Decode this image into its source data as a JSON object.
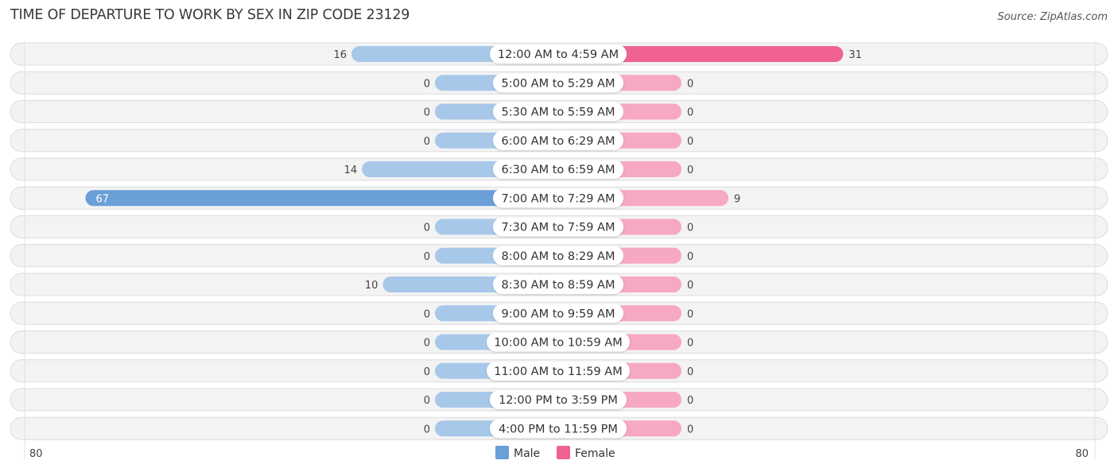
{
  "header": {
    "title": "TIME OF DEPARTURE TO WORK BY SEX IN ZIP CODE 23129",
    "source": "Source: ZipAtlas.com"
  },
  "chart_data": {
    "type": "bar",
    "orientation": "horizontal-diverging",
    "title": "TIME OF DEPARTURE TO WORK BY SEX IN ZIP CODE 23129",
    "categories": [
      "12:00 AM to 4:59 AM",
      "5:00 AM to 5:29 AM",
      "5:30 AM to 5:59 AM",
      "6:00 AM to 6:29 AM",
      "6:30 AM to 6:59 AM",
      "7:00 AM to 7:29 AM",
      "7:30 AM to 7:59 AM",
      "8:00 AM to 8:29 AM",
      "8:30 AM to 8:59 AM",
      "9:00 AM to 9:59 AM",
      "10:00 AM to 10:59 AM",
      "11:00 AM to 11:59 AM",
      "12:00 PM to 3:59 PM",
      "4:00 PM to 11:59 PM"
    ],
    "series": [
      {
        "name": "Male",
        "color": "#6a9fd8",
        "light_color": "#a8c8ea",
        "values": [
          16,
          0,
          0,
          0,
          14,
          67,
          0,
          0,
          10,
          0,
          0,
          0,
          0,
          0
        ]
      },
      {
        "name": "Female",
        "color": "#f06292",
        "light_color": "#f7a8c2",
        "values": [
          31,
          0,
          0,
          0,
          0,
          9,
          0,
          0,
          0,
          0,
          0,
          0,
          0,
          0
        ]
      }
    ],
    "axis": {
      "left_label": "80",
      "right_label": "80",
      "max": 80
    },
    "legend": {
      "position": "bottom-center",
      "items": [
        "Male",
        "Female"
      ]
    },
    "xlabel": "",
    "ylabel": ""
  }
}
